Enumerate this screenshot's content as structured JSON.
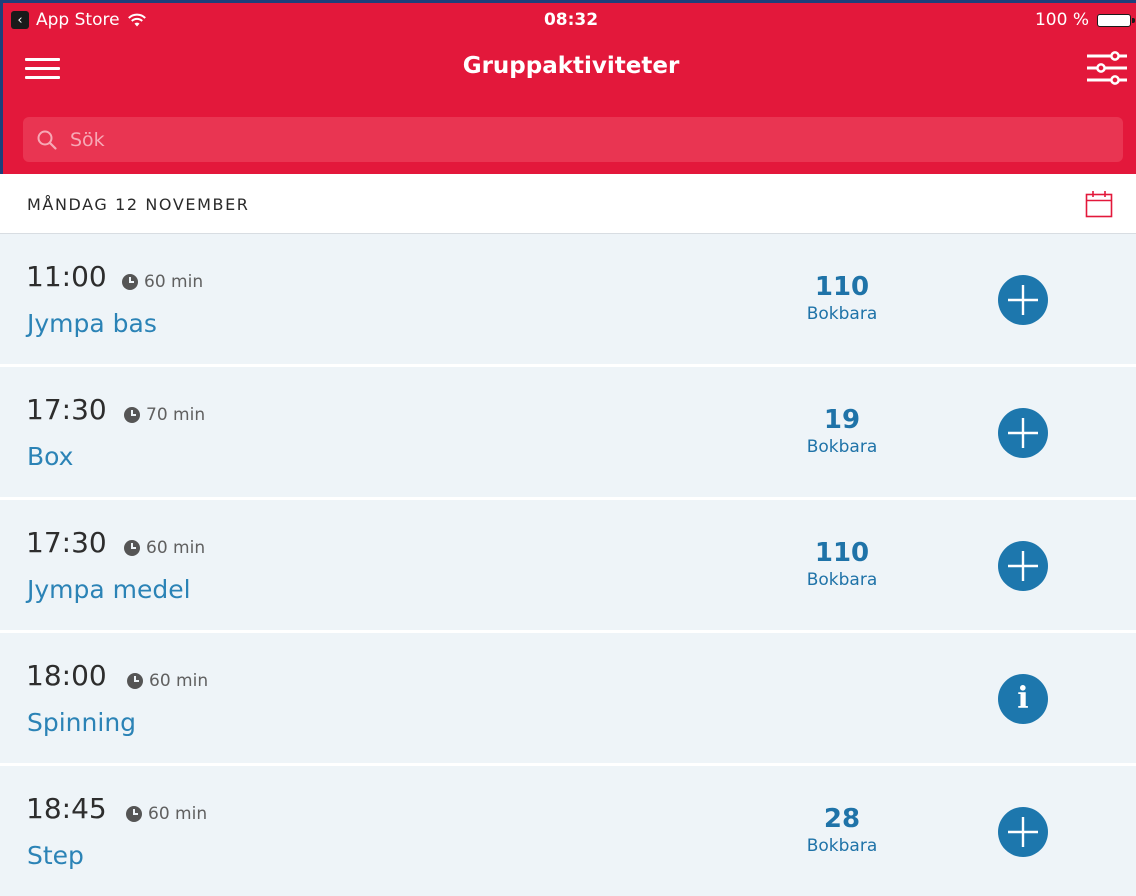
{
  "status_bar": {
    "back_app": "App Store",
    "time": "08:32",
    "battery": "100 %"
  },
  "navbar": {
    "title": "Gruppaktiviteter",
    "menu_icon": "hamburger-menu-icon",
    "filter_icon": "sliders-filter-icon"
  },
  "search": {
    "placeholder": "Sök",
    "value": ""
  },
  "date_bar": {
    "label": "MÅNDAG 12 NOVEMBER",
    "calendar_icon": "calendar-icon"
  },
  "colors": {
    "brand_red": "#e3183b",
    "accent_blue": "#1d77ad",
    "row_bg": "#eef4f8"
  },
  "activities": [
    {
      "time": "11:00",
      "duration": "60 min",
      "name": "Jympa bas",
      "count": "110",
      "count_label": "Bokbara",
      "action": "add"
    },
    {
      "time": "17:30",
      "duration": "70 min",
      "name": "Box",
      "count": "19",
      "count_label": "Bokbara",
      "action": "add"
    },
    {
      "time": "17:30",
      "duration": "60 min",
      "name": "Jympa medel",
      "count": "110",
      "count_label": "Bokbara",
      "action": "add"
    },
    {
      "time": "18:00",
      "duration": "60 min",
      "name": "Spinning",
      "count": "",
      "count_label": "",
      "action": "info"
    },
    {
      "time": "18:45",
      "duration": "60 min",
      "name": "Step",
      "count": "28",
      "count_label": "Bokbara",
      "action": "add"
    }
  ]
}
